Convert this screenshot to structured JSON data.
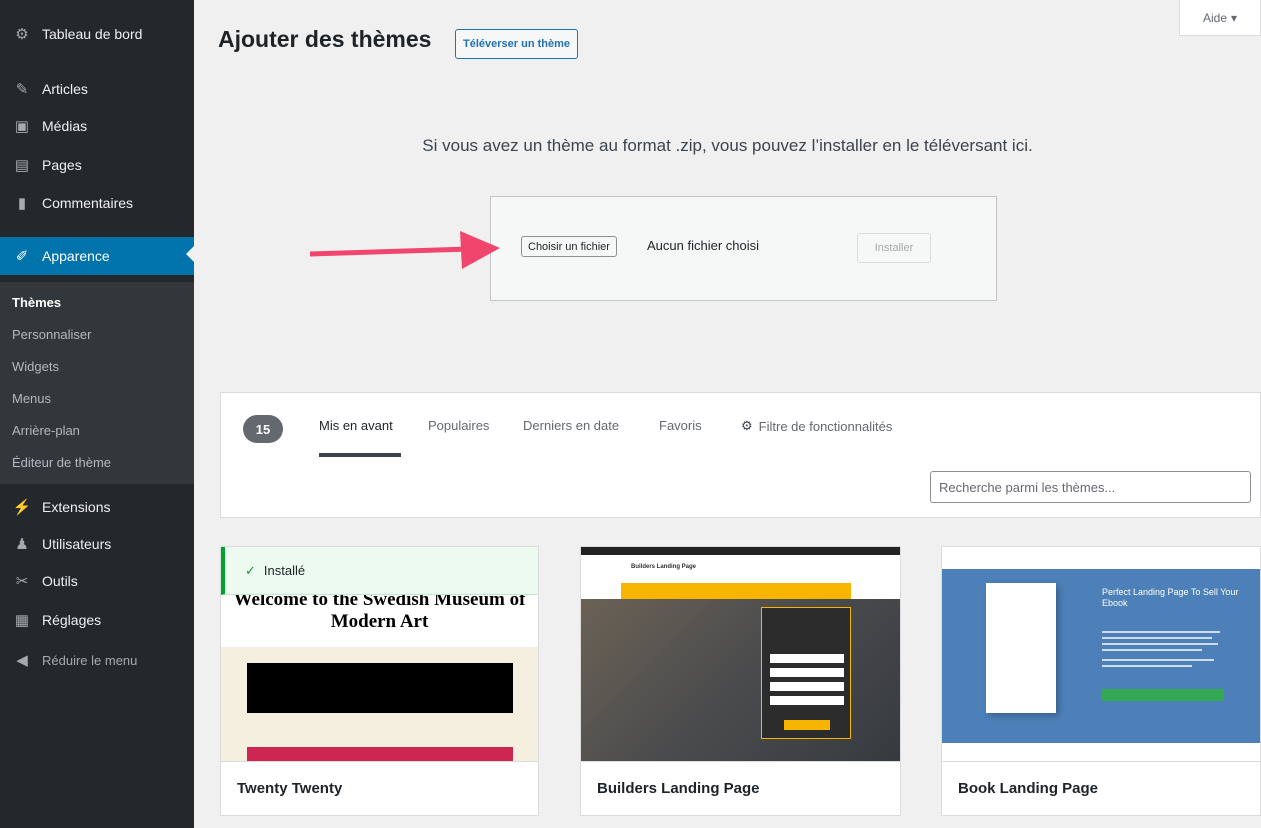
{
  "sidebar": {
    "items": [
      {
        "label": "Tableau de bord",
        "icon": "dashboard-icon",
        "glyph": "⚙"
      },
      {
        "label": "Articles",
        "icon": "pushpin-icon",
        "glyph": "✎"
      },
      {
        "label": "Médias",
        "icon": "media-icon",
        "glyph": "▣"
      },
      {
        "label": "Pages",
        "icon": "pages-icon",
        "glyph": "▤"
      },
      {
        "label": "Commentaires",
        "icon": "comment-icon",
        "glyph": "▮"
      },
      {
        "label": "Apparence",
        "icon": "paintbrush-icon",
        "glyph": "✐"
      },
      {
        "label": "Extensions",
        "icon": "plugin-icon",
        "glyph": "⚡"
      },
      {
        "label": "Utilisateurs",
        "icon": "users-icon",
        "glyph": "♟"
      },
      {
        "label": "Outils",
        "icon": "wrench-icon",
        "glyph": "✂"
      },
      {
        "label": "Réglages",
        "icon": "settings-icon",
        "glyph": "▦"
      },
      {
        "label": "Réduire le menu",
        "icon": "collapse-icon",
        "glyph": "◀"
      }
    ],
    "submenu": [
      "Thèmes",
      "Personnaliser",
      "Widgets",
      "Menus",
      "Arrière-plan",
      "Éditeur de thème"
    ]
  },
  "header": {
    "title": "Ajouter des thèmes",
    "upload_button": "Téléverser un thème",
    "help": "Aide"
  },
  "upload": {
    "description": "Si vous avez un thème au format .zip, vous pouvez l’installer en le téléversant ici.",
    "choose_file": "Choisir un fichier",
    "no_file": "Aucun fichier choisi",
    "install": "Installer"
  },
  "filter": {
    "count": "15",
    "tabs": [
      "Mis en avant",
      "Populaires",
      "Derniers en date",
      "Favoris"
    ],
    "feature_filter": "Filtre de fonctionnalités",
    "search_placeholder": "Recherche parmi les thèmes..."
  },
  "themes": [
    {
      "name": "Twenty Twenty",
      "installed_label": "Installé",
      "preview_heading": "Welcome to the Swedish Museum of Modern Art"
    },
    {
      "name": "Builders Landing Page",
      "preview_brand": "Builders Landing Page"
    },
    {
      "name": "Book Landing Page",
      "preview_heading": "Perfect Landing Page To Sell Your Ebook"
    }
  ],
  "colors": {
    "sidebar_bg": "#23282d",
    "active_menu": "#0073aa",
    "arrow": "#f0466e",
    "installed_green": "#00a32a"
  }
}
